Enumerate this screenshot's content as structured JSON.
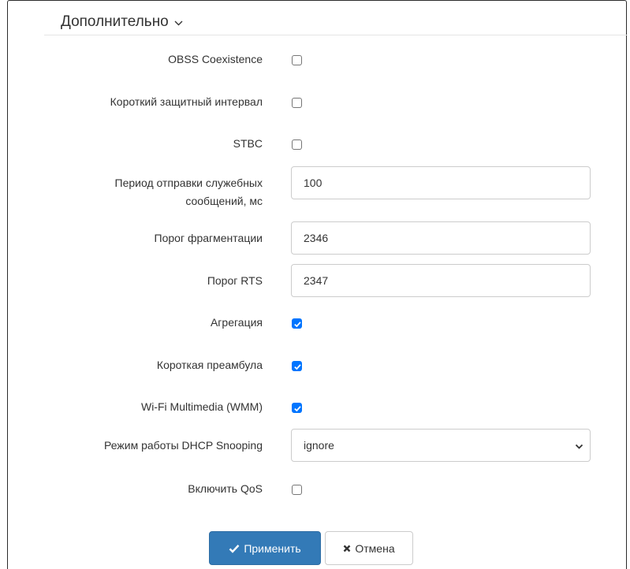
{
  "section": {
    "title": "Дополнительно",
    "chevron_icon": "chevron-down-icon"
  },
  "fields": {
    "obss": {
      "label": "OBSS Coexistence",
      "checked": false
    },
    "short_gi": {
      "label": "Короткий защитный интервал",
      "checked": false
    },
    "stbc": {
      "label": "STBC",
      "checked": false
    },
    "beacon_period": {
      "label_line1": "Период отправки служебных",
      "label_line2": "сообщений, мс",
      "value": "100"
    },
    "frag_threshold": {
      "label": "Порог фрагментации",
      "value": "2346"
    },
    "rts_threshold": {
      "label": "Порог RTS",
      "value": "2347"
    },
    "aggregation": {
      "label": "Агрегация",
      "checked": true
    },
    "short_preamble": {
      "label": "Короткая преамбула",
      "checked": true
    },
    "wmm": {
      "label": "Wi-Fi Multimedia (WMM)",
      "checked": true
    },
    "dhcp_snooping": {
      "label": "Режим работы DHCP Snooping",
      "value": "ignore"
    },
    "qos": {
      "label": "Включить QoS",
      "checked": false
    }
  },
  "buttons": {
    "apply": {
      "label": "Применить",
      "icon": "check-icon"
    },
    "cancel": {
      "label": "Отмена",
      "icon": "close-icon"
    }
  },
  "colors": {
    "primary": "#337ab7",
    "checkbox_accent": "#0075ff"
  }
}
